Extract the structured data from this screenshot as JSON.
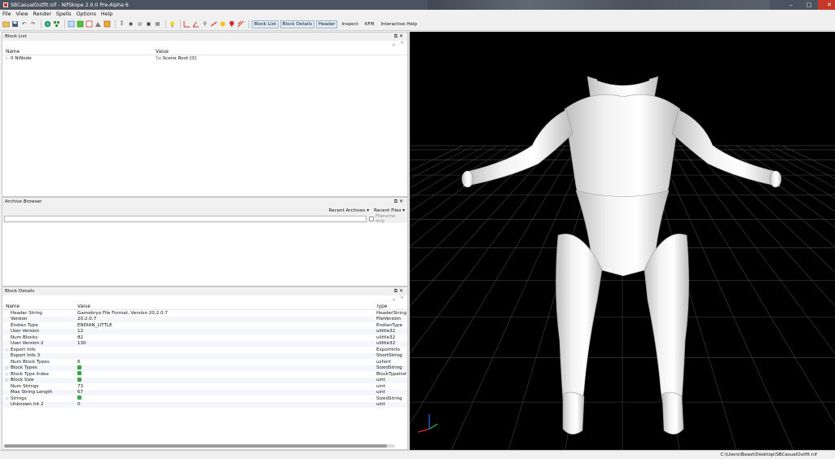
{
  "window": {
    "title": "SBCasualOutfit.nif - NifSkope 2.0.0 Pre-Alpha 6",
    "controls": [
      "–",
      "□",
      "✕"
    ]
  },
  "menu": [
    "File",
    "View",
    "Render",
    "Spells",
    "Options",
    "Help"
  ],
  "toolbar": {
    "text_buttons": [
      "Block List",
      "Block Details",
      "Header",
      "Inspect",
      "KFM",
      "Interactive Help"
    ]
  },
  "block_list": {
    "title": "Block List",
    "columns": [
      "Name",
      "Value"
    ],
    "rows": [
      {
        "name": "0 NiNode",
        "value": "Scene Root [0]"
      }
    ]
  },
  "archive_browser": {
    "title": "Archive Browser",
    "recent_archives": "Recent Archives",
    "recent_files": "Recent Files",
    "filename_only": "Filename only"
  },
  "block_details": {
    "title": "Block Details",
    "columns": [
      "Name",
      "Value",
      "Type"
    ],
    "rows": [
      {
        "name": "Header String",
        "value": "Gamebryo File Format, Version 20.2.0.7",
        "type": "HeaderString",
        "exp": false
      },
      {
        "name": "Version",
        "value": "20.2.0.7",
        "type": "FileVersion",
        "exp": false
      },
      {
        "name": "Endian Type",
        "value": "ENDIAN_LITTLE",
        "type": "EndianType",
        "exp": false
      },
      {
        "name": "User Version",
        "value": "12",
        "type": "ulittle32",
        "exp": false
      },
      {
        "name": "Num Blocks",
        "value": "82",
        "type": "ulittle32",
        "exp": false
      },
      {
        "name": "User Version 2",
        "value": "130",
        "type": "ulittle32",
        "exp": false
      },
      {
        "name": "Export Info",
        "value": "",
        "type": "ExportInfo",
        "exp": true
      },
      {
        "name": "Export Info 3",
        "value": "",
        "type": "ShortString",
        "exp": false
      },
      {
        "name": "Num Block Types",
        "value": "6",
        "type": "ushort",
        "exp": false
      },
      {
        "name": "Block Types",
        "value": "",
        "type": "SizedString",
        "exp": true,
        "icon": true
      },
      {
        "name": "Block Type Index",
        "value": "",
        "type": "BlockTypeInd",
        "exp": true,
        "icon": true
      },
      {
        "name": "Block Size",
        "value": "",
        "type": "uint",
        "exp": true,
        "icon": true
      },
      {
        "name": "Num Strings",
        "value": "73",
        "type": "uint",
        "exp": false
      },
      {
        "name": "Max String Length",
        "value": "67",
        "type": "uint",
        "exp": false
      },
      {
        "name": "Strings",
        "value": "",
        "type": "SizedString",
        "exp": true,
        "icon": true
      },
      {
        "name": "Unknown Int 2",
        "value": "0",
        "type": "uint",
        "exp": false
      }
    ]
  },
  "status": {
    "path": "C:\\Users\\Beast\\Desktop\\SBCasualOutfit.nif"
  },
  "viewport": {
    "background": "#000000",
    "model_color": "#e8e8e8",
    "grid_color": "#3a3a3a"
  }
}
